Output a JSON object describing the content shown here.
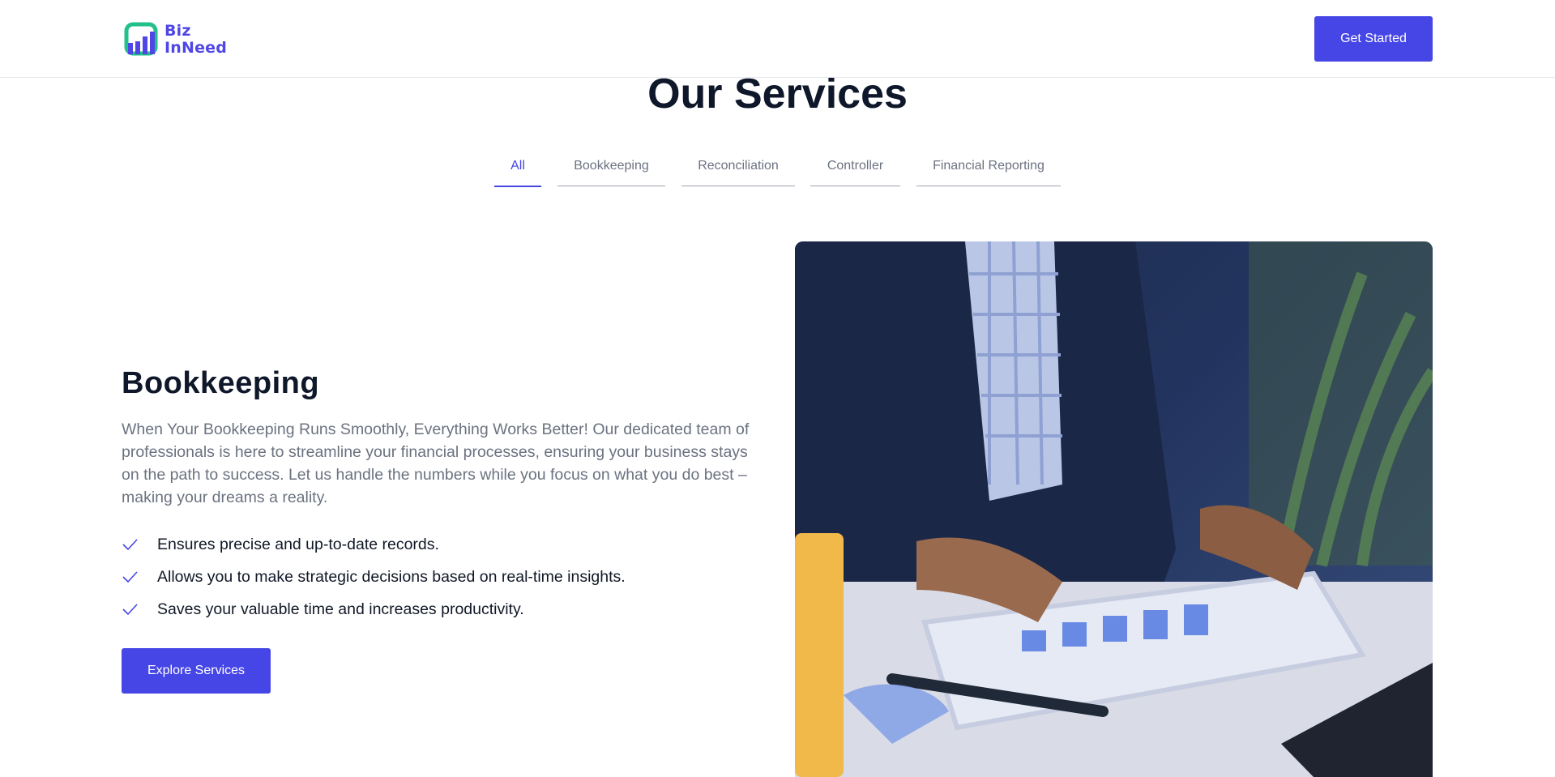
{
  "header": {
    "logo": {
      "line1": "Biz",
      "line2": "InNeed"
    },
    "cta_label": "Get Started"
  },
  "section": {
    "title": "Our Services"
  },
  "tabs": [
    {
      "label": "All",
      "active": true
    },
    {
      "label": "Bookkeeping",
      "active": false
    },
    {
      "label": "Reconciliation",
      "active": false
    },
    {
      "label": "Controller",
      "active": false
    },
    {
      "label": "Financial Reporting",
      "active": false
    }
  ],
  "content": {
    "title": "Bookkeeping",
    "description": "When Your Bookkeeping Runs Smoothly, Everything Works Better! Our dedicated team of professionals is here to streamline your financial processes, ensuring your business stays on the path to success. Let us handle the numbers while you focus on what you do best – making your dreams a reality.",
    "features": [
      "Ensures precise and up-to-date records.",
      "Allows you to make strategic decisions based on real-time insights.",
      "Saves your valuable time and increases productivity."
    ],
    "cta_label": "Explore Services"
  },
  "colors": {
    "accent": "#4646e6",
    "logo_green": "#22c08a",
    "heading": "#0f172a",
    "muted": "#6b7280"
  },
  "icons": [
    "logo-icon",
    "check-icon"
  ]
}
